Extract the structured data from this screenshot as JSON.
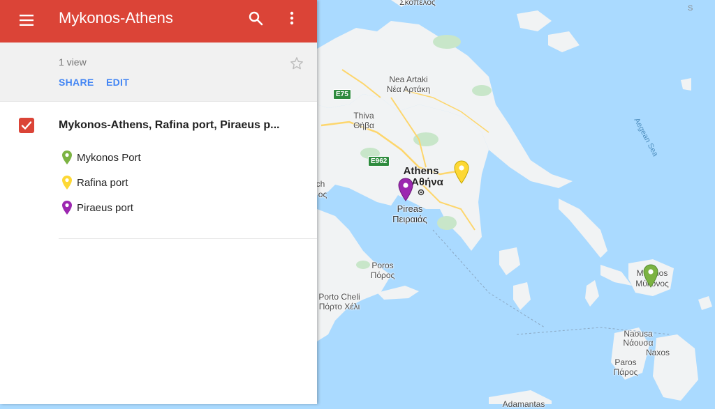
{
  "map_title": "Mykonos-Athens",
  "info": {
    "views": "1 view",
    "share_label": "SHARE",
    "edit_label": "EDIT"
  },
  "layer": {
    "title": "Mykonos-Athens, Rafina port, Piraeus p...",
    "checked": true,
    "places": [
      {
        "label": "Mykonos Port",
        "color": "#7cb342"
      },
      {
        "label": "Rafina port",
        "color": "#fdd835"
      },
      {
        "label": "Piraeus port",
        "color": "#9c27b0"
      }
    ]
  },
  "colors": {
    "header": "#db4437",
    "link": "#4285f4",
    "water": "#aadaff",
    "land": "#f1f3f4",
    "park": "#c8e6c9",
    "road": "#fdd66c"
  },
  "map": {
    "labels": {
      "skopelos": "Σκόπελος",
      "nea_artaki": "Nea Artaki",
      "nea_artaki_gr": "Νέα Αρτάκη",
      "thiva": "Thiva",
      "thiva_gr": "Θήβα",
      "athens": "Athens",
      "athens_gr": "Αθήνα",
      "pireas": "Pireas",
      "pireas_gr": "Πειραιάς",
      "poros": "Poros",
      "poros_gr": "Πόρος",
      "porto_cheli": "Porto Cheli",
      "porto_cheli_gr": "Πόρτο Χέλι",
      "aegean_sea": "Aegean Sea",
      "mykonos": "Mikonos",
      "mykonos_gr": "Μύκονος",
      "naousa": "Naousa",
      "naousa_gr": "Νάουσα",
      "paros": "Paros",
      "paros_gr": "Πάρος",
      "naxos": "Naxos",
      "adamantas": "Adamantas",
      "partial_ch": "ch",
      "partial_os": "ος"
    },
    "roads": {
      "e75": "E75",
      "e962": "E962"
    }
  }
}
